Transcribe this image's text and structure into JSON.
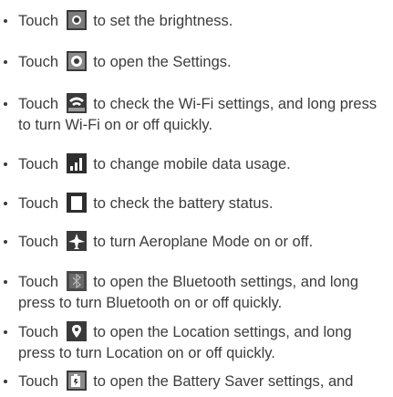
{
  "items": [
    {
      "before": "Touch",
      "icon": "brightness-icon",
      "after": "to set the brightness."
    },
    {
      "before": "Touch",
      "icon": "settings-icon",
      "after": "to open the Settings."
    },
    {
      "before": "Touch",
      "icon": "wifi-icon",
      "after": "to check the Wi-Fi settings, and long press to turn Wi-Fi on or off quickly."
    },
    {
      "before": "Touch",
      "icon": "mobile-data-icon",
      "after": "to change mobile data usage."
    },
    {
      "before": "Touch",
      "icon": "battery-icon",
      "after": "to check the battery status."
    },
    {
      "before": "Touch",
      "icon": "aeroplane-mode-icon",
      "after": "to turn Aeroplane Mode on or off."
    },
    {
      "before": "Touch",
      "icon": "bluetooth-icon",
      "after": "to open the Bluetooth settings, and long press to turn Bluetooth on or off quickly."
    },
    {
      "before": "Touch",
      "icon": "location-icon",
      "after": "to open the Location settings, and long press to turn Location on or off quickly."
    },
    {
      "before": "Touch",
      "icon": "battery-saver-icon",
      "after": "to open the Battery Saver settings, and"
    }
  ]
}
